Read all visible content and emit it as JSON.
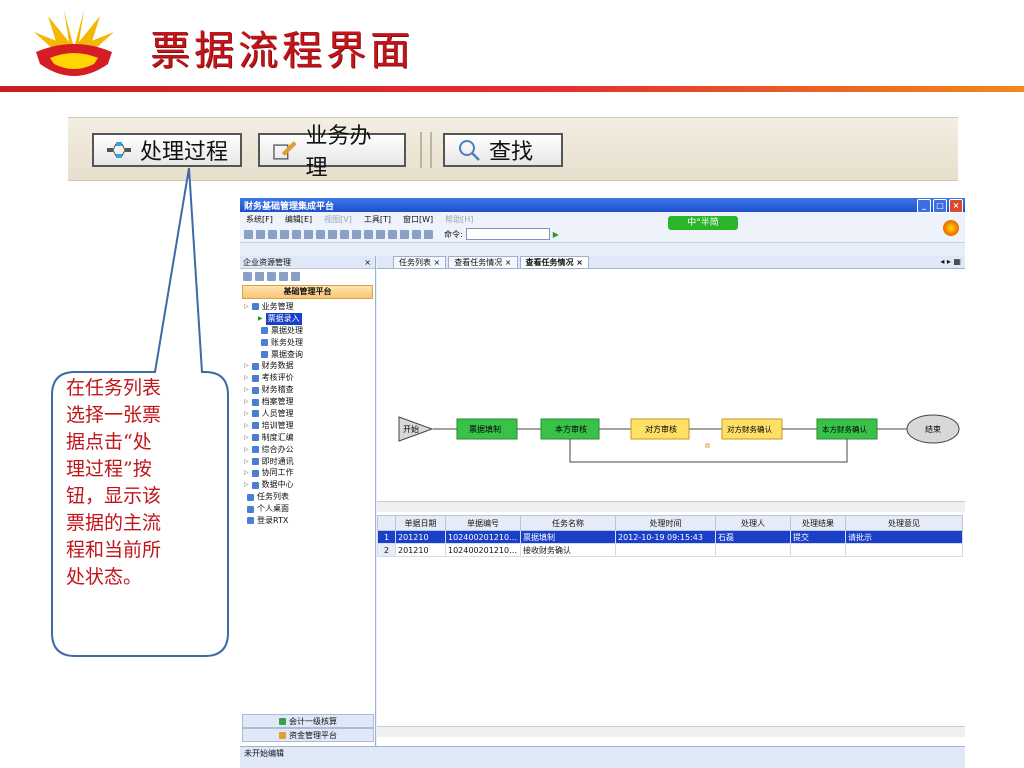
{
  "slide": {
    "title": "票据流程界面"
  },
  "toolbar": {
    "process_label": "处理过程",
    "business_label": "业务办理",
    "search_label": "查找"
  },
  "app": {
    "title": "财务基础管理集成平台",
    "menu": [
      "系统[F]",
      "编辑[E]",
      "视图[V]",
      "工具[T]",
      "窗口[W]",
      "帮助[H]"
    ],
    "command_label": "命令:",
    "lang_badge": "中°半简",
    "left_panel": {
      "header": "企业资源管理",
      "platform": "基础管理平台",
      "tree": [
        {
          "label": "业务管理",
          "level": 0
        },
        {
          "label": "票据录入",
          "level": 1,
          "selected": true
        },
        {
          "label": "票据处理",
          "level": 1
        },
        {
          "label": "账务处理",
          "level": 1
        },
        {
          "label": "票据查询",
          "level": 1
        },
        {
          "label": "财务数据",
          "level": 0
        },
        {
          "label": "考核评价",
          "level": 0
        },
        {
          "label": "财务稽查",
          "level": 0
        },
        {
          "label": "档案管理",
          "level": 0
        },
        {
          "label": "人员管理",
          "level": 0
        },
        {
          "label": "培训管理",
          "level": 0
        },
        {
          "label": "制度汇编",
          "level": 0
        },
        {
          "label": "综合办公",
          "level": 0
        },
        {
          "label": "即时通讯",
          "level": 0
        },
        {
          "label": "协同工作",
          "level": 0
        },
        {
          "label": "数据中心",
          "level": 0
        },
        {
          "label": "任务列表",
          "level": 0
        },
        {
          "label": "个人桌面",
          "level": 0
        },
        {
          "label": "登录RTX",
          "level": 0
        }
      ],
      "bottom_buttons": [
        "会计一级核算",
        "资金管理平台"
      ]
    },
    "tabs": [
      {
        "label": "任务列表",
        "active": false
      },
      {
        "label": "查看任务情况",
        "active": false
      },
      {
        "label": "查看任务情况",
        "active": true
      }
    ],
    "flow": {
      "start": "开始",
      "end": "结束",
      "nodes": [
        {
          "label": "票据填制",
          "color": "#39c24a"
        },
        {
          "label": "本方审核",
          "color": "#39c24a"
        },
        {
          "label": "对方审核",
          "color": "#ffe066"
        },
        {
          "label": "对方财务确认",
          "color": "#ffe066"
        },
        {
          "label": "本方财务确认",
          "color": "#39c24a"
        }
      ]
    },
    "table": {
      "columns": [
        "单据日期",
        "单据编号",
        "任务名称",
        "处理时间",
        "处理人",
        "处理结果",
        "处理意见"
      ],
      "rows": [
        [
          "1",
          "201210",
          "102400201210000...",
          "票据填制",
          "2012-10-19 09:15:43",
          "石磊",
          "提交",
          "请批示"
        ],
        [
          "2",
          "201210",
          "102400201210000...",
          "接收财务确认",
          "",
          "",
          "",
          ""
        ]
      ]
    },
    "status_text": "未开始编辑"
  },
  "callout": {
    "lines": [
      "在任务列表",
      "选择一张票",
      "据点击“处",
      "理过程”按",
      "钮，显示该",
      "票据的主流",
      "程和当前所",
      "处状态。"
    ]
  }
}
